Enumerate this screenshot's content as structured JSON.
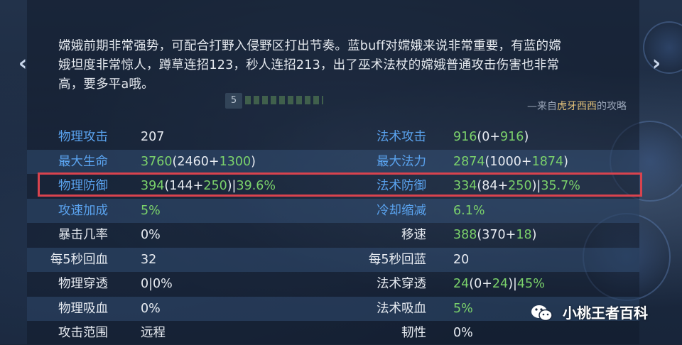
{
  "description": "嫦娥前期非常强势，可配合打野入侵野区打出节奏。蓝buff对嫦娥来说非常重要，有蓝的嫦娥坦度非常惊人，蹲草连招123，秒人连招213，出了巫术法杖的嫦娥普通攻击伤害也非常高，要多平a哦。",
  "desc_lines": [
    "嫦娥前期非常强势，可配合打野入侵野区打出节奏。蓝buff对嫦娥来说非常重要，有蓝的嫦",
    "娥坦度非常惊人，蹲草连招123，秒人连招213，出了巫术法杖的嫦娥普通攻击伤害也非常",
    "高，要多平a哦。"
  ],
  "source": {
    "prefix": "—来自",
    "author": "虎牙西西",
    "suffix": "的攻略"
  },
  "level_badge": "5",
  "nav": {
    "prev_icon": "chevron-left-icon",
    "next_icon": "chevron-right-icon"
  },
  "colors": {
    "label_blue": "#5aa3ef",
    "bonus_green": "#7bd26b",
    "highlight_red": "#d9434e",
    "author_gold": "#e3c27a"
  },
  "stats": [
    {
      "shade": false,
      "left": {
        "label": "物理攻击",
        "label_color": "blue",
        "value": [
          [
            "207",
            "white"
          ]
        ]
      },
      "right": {
        "label": "法术攻击",
        "label_color": "blue",
        "value": [
          [
            "916",
            "green"
          ],
          [
            "(0+",
            "white"
          ],
          [
            "916",
            "green"
          ],
          [
            ")",
            "white"
          ]
        ]
      }
    },
    {
      "shade": true,
      "left": {
        "label": "最大生命",
        "label_color": "blue",
        "value": [
          [
            "3760",
            "green"
          ],
          [
            "(2460+",
            "white"
          ],
          [
            "1300",
            "green"
          ],
          [
            ")",
            "white"
          ]
        ]
      },
      "right": {
        "label": "最大法力",
        "label_color": "blue",
        "value": [
          [
            "2874",
            "green"
          ],
          [
            "(1000+",
            "white"
          ],
          [
            "1874",
            "green"
          ],
          [
            ")",
            "white"
          ]
        ]
      }
    },
    {
      "shade": false,
      "left": {
        "label": "物理防御",
        "label_color": "blue",
        "value": [
          [
            "394",
            "green"
          ],
          [
            "(144+",
            "white"
          ],
          [
            "250",
            "green"
          ],
          [
            ")|",
            "white"
          ],
          [
            "39.6%",
            "green"
          ]
        ]
      },
      "right": {
        "label": "法术防御",
        "label_color": "blue",
        "value": [
          [
            "334",
            "green"
          ],
          [
            "(84+",
            "white"
          ],
          [
            "250",
            "green"
          ],
          [
            ")|",
            "white"
          ],
          [
            "35.7%",
            "green"
          ]
        ]
      }
    },
    {
      "shade": true,
      "left": {
        "label": "攻速加成",
        "label_color": "blue",
        "value": [
          [
            "5%",
            "green"
          ]
        ]
      },
      "right": {
        "label": "冷却缩减",
        "label_color": "blue",
        "value": [
          [
            "6.1%",
            "green"
          ]
        ]
      }
    },
    {
      "shade": false,
      "left": {
        "label": "暴击几率",
        "label_color": "white",
        "value": [
          [
            "0%",
            "white"
          ]
        ]
      },
      "right": {
        "label": "移速",
        "label_color": "white",
        "value": [
          [
            "388",
            "green"
          ],
          [
            "(370+",
            "white"
          ],
          [
            "18",
            "green"
          ],
          [
            ")",
            "white"
          ]
        ]
      }
    },
    {
      "shade": true,
      "left": {
        "label": "每5秒回血",
        "label_color": "white",
        "value": [
          [
            "32",
            "white"
          ]
        ]
      },
      "right": {
        "label": "每5秒回蓝",
        "label_color": "white",
        "value": [
          [
            "20",
            "white"
          ]
        ]
      }
    },
    {
      "shade": false,
      "left": {
        "label": "物理穿透",
        "label_color": "white",
        "value": [
          [
            "0|0%",
            "white"
          ]
        ]
      },
      "right": {
        "label": "法术穿透",
        "label_color": "white",
        "value": [
          [
            "24",
            "green"
          ],
          [
            "(0+",
            "white"
          ],
          [
            "24",
            "green"
          ],
          [
            ")|",
            "white"
          ],
          [
            "45%",
            "green"
          ]
        ]
      }
    },
    {
      "shade": true,
      "left": {
        "label": "物理吸血",
        "label_color": "white",
        "value": [
          [
            "0%",
            "white"
          ]
        ]
      },
      "right": {
        "label": "法术吸血",
        "label_color": "white",
        "value": [
          [
            "5%",
            "green"
          ]
        ]
      }
    },
    {
      "shade": false,
      "left": {
        "label": "攻击范围",
        "label_color": "white",
        "value": [
          [
            "远程",
            "white"
          ]
        ]
      },
      "right": {
        "label": "韧性",
        "label_color": "white",
        "value": [
          [
            "0%",
            "white"
          ]
        ]
      }
    }
  ],
  "watermark": {
    "text": "小桃王者百科",
    "icon": "wechat-icon"
  }
}
